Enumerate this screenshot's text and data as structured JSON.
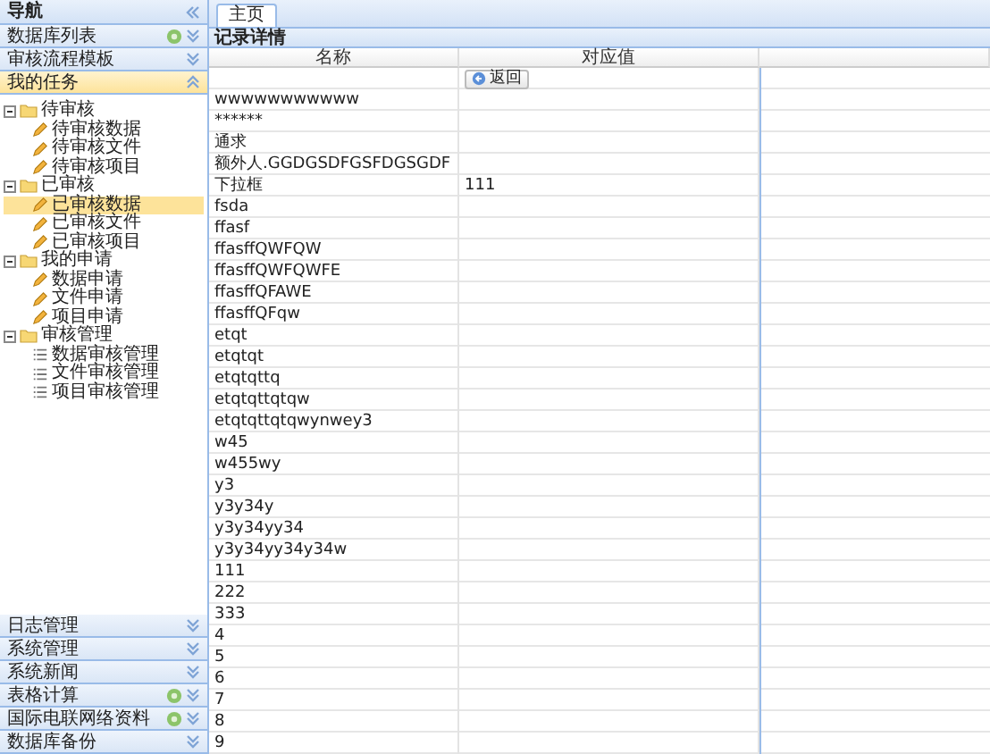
{
  "sidebar": {
    "title": "导航",
    "top_panels": [
      {
        "label": "数据库列表",
        "gear": true,
        "expanded": false
      },
      {
        "label": "审核流程模板",
        "gear": false,
        "expanded": false
      },
      {
        "label": "我的任务",
        "gear": false,
        "expanded": true
      }
    ],
    "tree": [
      {
        "label": "待审核",
        "expanded": true,
        "selected": false,
        "children": [
          {
            "label": "待审核数据",
            "kind": "edit",
            "selected": false
          },
          {
            "label": "待审核文件",
            "kind": "edit",
            "selected": false
          },
          {
            "label": "待审核项目",
            "kind": "edit",
            "selected": false
          }
        ]
      },
      {
        "label": "已审核",
        "expanded": true,
        "selected": false,
        "children": [
          {
            "label": "已审核数据",
            "kind": "edit",
            "selected": true
          },
          {
            "label": "已审核文件",
            "kind": "edit",
            "selected": false
          },
          {
            "label": "已审核项目",
            "kind": "edit",
            "selected": false
          }
        ]
      },
      {
        "label": "我的申请",
        "expanded": true,
        "selected": false,
        "children": [
          {
            "label": "数据申请",
            "kind": "edit",
            "selected": false
          },
          {
            "label": "文件申请",
            "kind": "edit",
            "selected": false
          },
          {
            "label": "项目申请",
            "kind": "edit",
            "selected": false
          }
        ]
      },
      {
        "label": "审核管理",
        "expanded": true,
        "selected": false,
        "children": [
          {
            "label": "数据审核管理",
            "kind": "list",
            "selected": false
          },
          {
            "label": "文件审核管理",
            "kind": "list",
            "selected": false
          },
          {
            "label": "项目审核管理",
            "kind": "list",
            "selected": false
          }
        ]
      }
    ],
    "bottom_panels": [
      {
        "label": "日志管理",
        "gear": false,
        "expanded": false
      },
      {
        "label": "系统管理",
        "gear": false,
        "expanded": false
      },
      {
        "label": "系统新闻",
        "gear": false,
        "expanded": false
      },
      {
        "label": "表格计算",
        "gear": true,
        "expanded": false
      },
      {
        "label": "国际电联网络资料",
        "gear": true,
        "expanded": false
      },
      {
        "label": "数据库备份",
        "gear": false,
        "expanded": false
      }
    ]
  },
  "tabs": [
    {
      "label": "主页",
      "selected": true
    }
  ],
  "panel": {
    "title": "记录详情"
  },
  "table": {
    "columns": [
      "名称",
      "对应值"
    ],
    "rows": [
      {
        "kind": "action",
        "button": "返回"
      },
      {
        "kind": "field",
        "name": "wwwwwwwwwww"
      },
      {
        "kind": "field",
        "name": "******"
      },
      {
        "kind": "field",
        "name": "通求"
      },
      {
        "kind": "field",
        "name": "额外人.GGDGSDFGSFDGSGDF"
      },
      {
        "kind": "field",
        "name": "下拉框",
        "value": "111"
      },
      {
        "kind": "field",
        "name": "fsda"
      },
      {
        "kind": "field",
        "name": "ffasf"
      },
      {
        "kind": "field",
        "name": "ffasffQWFQW"
      },
      {
        "kind": "field",
        "name": "ffasffQWFQWFE"
      },
      {
        "kind": "field",
        "name": "ffasffQFAWE"
      },
      {
        "kind": "field",
        "name": "ffasffQFqw"
      },
      {
        "kind": "field",
        "name": "etqt"
      },
      {
        "kind": "field",
        "name": "etqtqt"
      },
      {
        "kind": "field",
        "name": "etqtqttq"
      },
      {
        "kind": "field",
        "name": "etqtqttqtqw"
      },
      {
        "kind": "field",
        "name": "etqtqttqtqwynwey3"
      },
      {
        "kind": "field",
        "name": "w45"
      },
      {
        "kind": "field",
        "name": "w455wy"
      },
      {
        "kind": "field",
        "name": "y3"
      },
      {
        "kind": "field",
        "name": "y3y34y"
      },
      {
        "kind": "field",
        "name": "y3y34yy34"
      },
      {
        "kind": "field",
        "name": "y3y34yy34y34w"
      },
      {
        "kind": "field",
        "name": "111"
      },
      {
        "kind": "field",
        "name": "222"
      },
      {
        "kind": "field",
        "name": "333"
      },
      {
        "kind": "field",
        "name": "4"
      },
      {
        "kind": "field",
        "name": "5"
      },
      {
        "kind": "field",
        "name": "6"
      },
      {
        "kind": "field",
        "name": "7"
      },
      {
        "kind": "field",
        "name": "8"
      },
      {
        "kind": "field",
        "name": "9"
      }
    ]
  }
}
